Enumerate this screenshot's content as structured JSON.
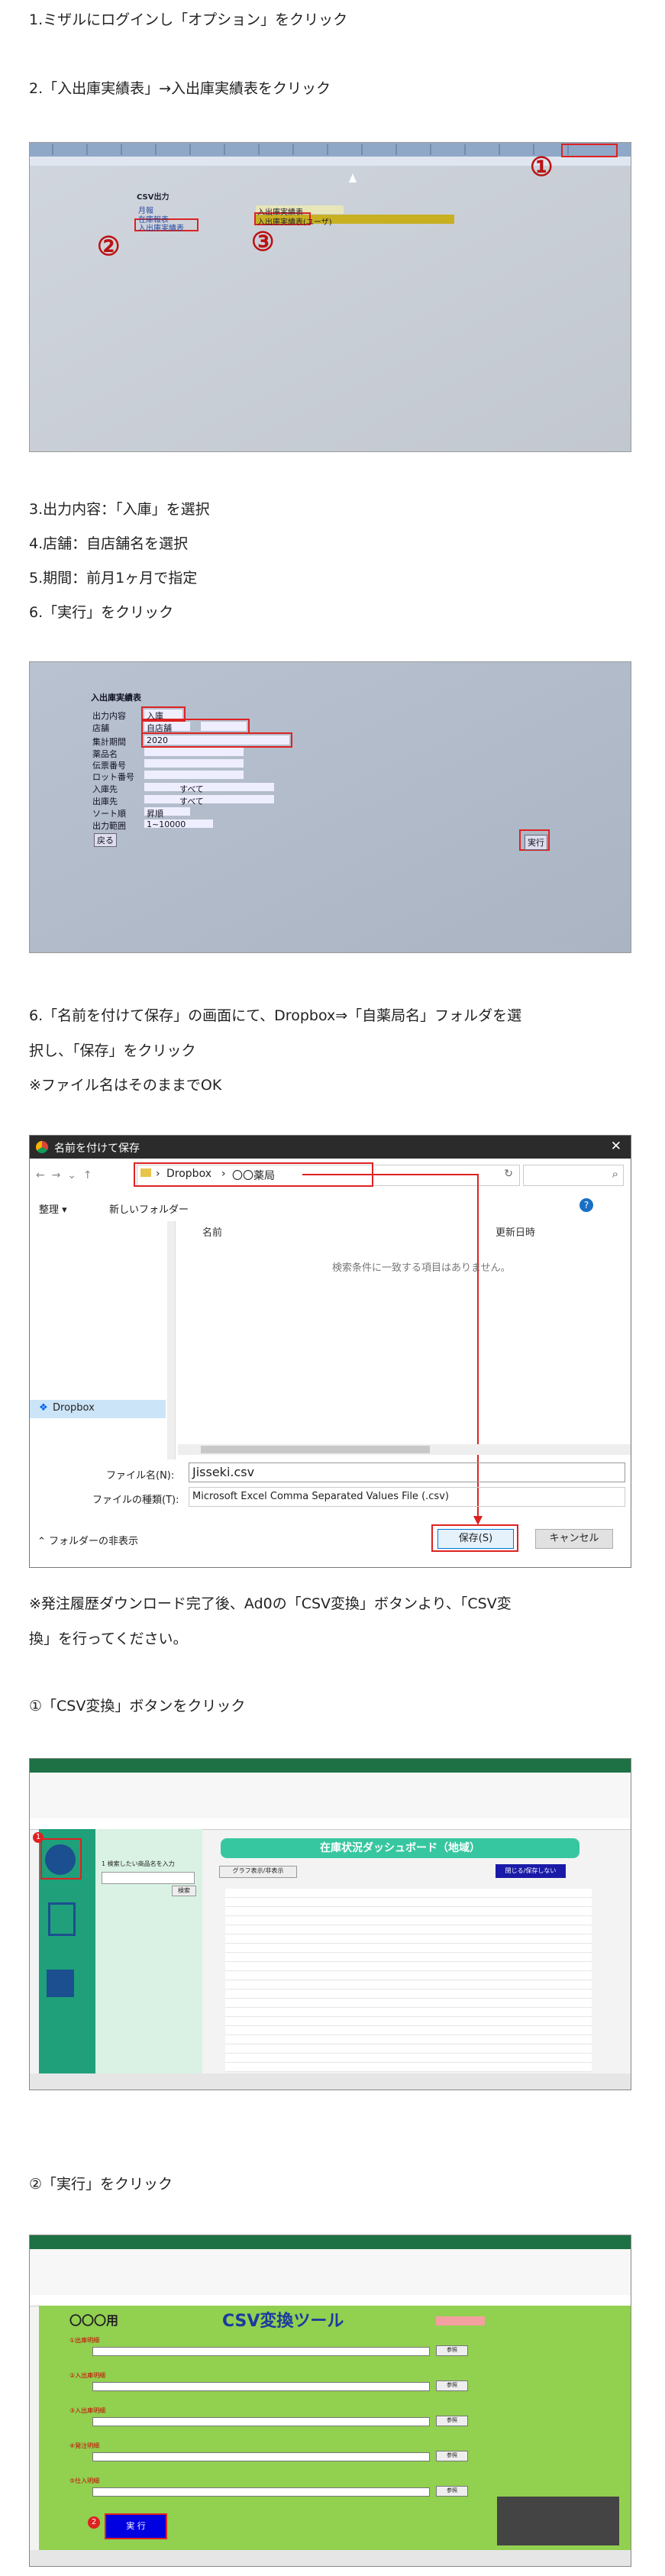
{
  "steps": {
    "s1": "1.ミザルにログインし「オプション」をクリック",
    "s2": "2.「入出庫実績表」→入出庫実績表をクリック",
    "s3": "3.出力内容：「入庫」を選択",
    "s4": "4.店舗：自店舗名を選択",
    "s5": "5.期間：前月1ヶ月で指定",
    "s6": "6.「実行」をクリック",
    "s7a": "6.「名前を付けて保存」の画面にて、Dropbox⇒「自薬局名」フォルダを選",
    "s7b": "択し、「保存」をクリック",
    "s7c": "※ファイル名はそのままでOK",
    "note_a": "※発注履歴ダウンロード完了後、Ad0の「CSV変換」ボタンより、「CSV変",
    "note_b": "換」を行ってください。",
    "c1": "①「CSV変換」ボタンをクリック",
    "c2": "②「実行」をクリック"
  },
  "shot1": {
    "menu_label": "CSV出力",
    "items": [
      "月報",
      "在庫報表",
      "入出庫実績表",
      "入出庫実績表"
    ],
    "sub_items": [
      "入出庫実績表",
      "入出庫実績表(ユーザ)"
    ],
    "nums": [
      "①",
      "②",
      "③"
    ]
  },
  "shot2": {
    "section": "入出庫実績表",
    "rows": [
      "出力内容",
      "店舗",
      "集計期間",
      "薬品名",
      "伝票番号",
      "ロット番号",
      "入庫先",
      "出庫先",
      "ソート順",
      "出力範囲"
    ],
    "values": [
      "入庫",
      "自店舗",
      "2020",
      "",
      "",
      "",
      "すべて",
      "すべて",
      "昇順",
      "1~10000"
    ],
    "button": "実行",
    "small_button": "戻る"
  },
  "dialog": {
    "title": "名前を付けて保存",
    "path": [
      "Dropbox",
      "〇〇薬局"
    ],
    "organize": "整理",
    "new_folder": "新しいフォルダー",
    "col_name": "名前",
    "col_date": "更新日時",
    "empty": "検索条件に一致する項目はありません。",
    "sidebar_item": "Dropbox",
    "filename_label": "ファイル名(N):",
    "filename": "Jisseki.csv",
    "type_label": "ファイルの種類(T):",
    "type": "Microsoft Excel Comma Separated Values File (.csv)",
    "hide_folders": "フォルダーの非表示",
    "save": "保存(S)",
    "cancel": "キャンセル"
  },
  "excel1": {
    "title": "在庫状況ダッシュボード（地域）",
    "panel_label": "1 検索したい商品名を入力",
    "search_button": "検索",
    "graph_button": "グラフ表示/非表示",
    "blue_button": "閉じる/保存しない",
    "badge": "1"
  },
  "excel2": {
    "left_title": "〇〇〇用",
    "title": "CSV変換ツール",
    "run_button": "実 行",
    "badge": "2",
    "sections": [
      "①出庫明細",
      "②入出庫明細",
      "③入出庫明細",
      "④発注明細",
      "⑤仕入明細"
    ],
    "ref_button": "参照"
  }
}
